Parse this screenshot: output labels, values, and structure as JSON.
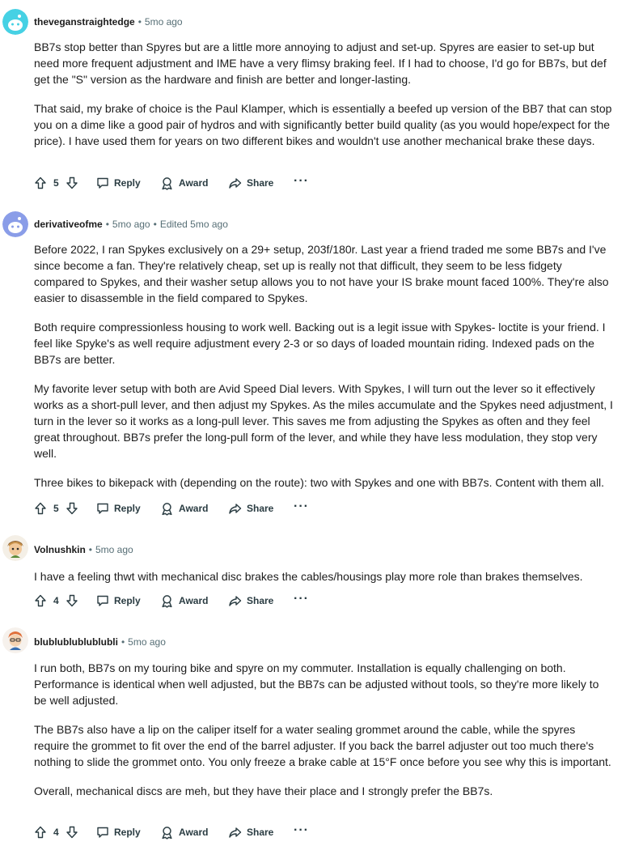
{
  "comments": [
    {
      "username": "theveganstraightedge",
      "time": "5mo ago",
      "edited": "",
      "paragraphs": [
        "BB7s stop better than Spyres but are a little more annoying to adjust and set-up. Spyres are easier to set-up but need more frequent adjustment and IME have a very flimsy braking feel. If I had to choose, I'd go for BB7s, but def get the \"S\" version as the hardware and finish are better and longer-lasting.",
        "That said, my brake of choice is the Paul Klamper, which is essentially a beefed up version of the BB7 that can stop you on a dime like a good pair of hydros and with significantly better build quality (as you would hope/expect for the price). I have used them for years on two different bikes and wouldn't use another mechanical brake these days."
      ],
      "votes": "5",
      "avatar_color": "#46d1e4"
    },
    {
      "username": "derivativeofme",
      "time": "5mo ago",
      "edited": "Edited 5mo ago",
      "paragraphs": [
        "Before 2022, I ran Spykes exclusively on a 29+ setup, 203f/180r. Last year a friend traded me some BB7s and I've since become a fan. They're relatively cheap, set up is really not that difficult, they seem to be less fidgety compared to Spykes, and their washer setup allows you to not have your IS brake mount faced 100%. They're also easier to disassemble in the field compared to Spykes.",
        "Both require compressionless housing to work well. Backing out is a legit issue with Spykes- loctite is your friend. I feel like Spyke's as well require adjustment every 2-3 or so days of loaded mountain riding. Indexed pads on the BB7s are better.",
        "My favorite lever setup with both are Avid Speed Dial levers. With Spykes, I will turn out the lever so it effectively works as a short-pull lever, and then adjust my Spykes. As the miles accumulate and the Spykes need adjustment, I turn in the lever so it works as a long-pull lever. This saves me from adjusting the Spykes as often and they feel great throughout. BB7s prefer the long-pull form of the lever, and while they have less modulation, they stop very well.",
        "Three bikes to bikepack with (depending on the route): two with Spykes and one with BB7s. Content with them all."
      ],
      "votes": "5",
      "avatar_color": "#8a9de8"
    },
    {
      "username": "Volnushkin",
      "time": "5mo ago",
      "edited": "",
      "paragraphs": [
        "I have a feeling thwt with mechanical disc brakes the cables/housings play more role than brakes themselves."
      ],
      "votes": "4",
      "avatar_color": "#c8924a"
    },
    {
      "username": "blublublublublubli",
      "time": "5mo ago",
      "edited": "",
      "paragraphs": [
        "I run both, BB7s on my touring bike and spyre on my commuter. Installation is equally challenging on both. Performance is identical when well adjusted, but the BB7s can be adjusted without tools, so they're more likely to be well adjusted.",
        "The BB7s also have a lip on the caliper itself for a water sealing grommet around the cable, while the spyres require the grommet to fit over the end of the barrel adjuster. If you back the barrel adjuster out too much there's nothing to slide the grommet onto. You only freeze a brake cable at 15°F once before you see why this is important.",
        "Overall, mechanical discs are meh, but they have their place and I strongly prefer the BB7s."
      ],
      "votes": "4",
      "avatar_color": "#e0703a"
    }
  ],
  "actions": {
    "reply": "Reply",
    "award": "Award",
    "share": "Share",
    "more": "···"
  }
}
